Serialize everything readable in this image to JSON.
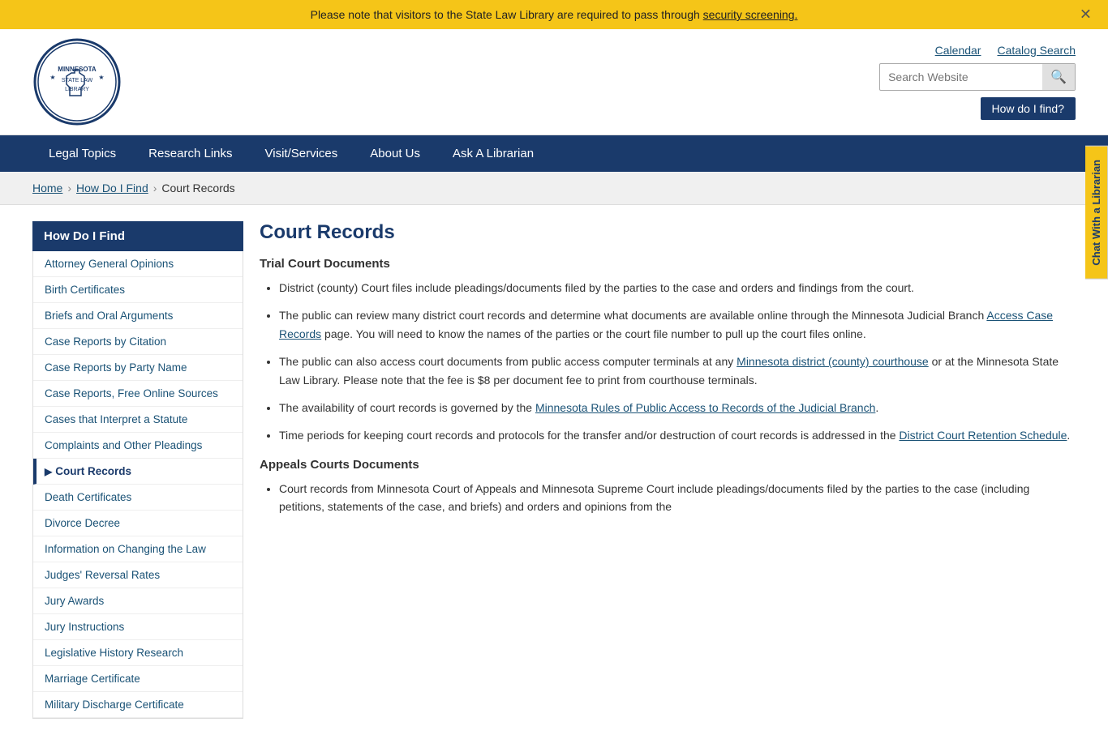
{
  "banner": {
    "text": "Please note that visitors to the State Law Library are required to pass through ",
    "link_text": "security screening.",
    "close_icon": "✕"
  },
  "header": {
    "links": [
      "Calendar",
      "Catalog Search"
    ],
    "search_placeholder": "Search Website",
    "how_do_i_find": "How do I find?",
    "logo_alt": "Minnesota State Law Library"
  },
  "nav": {
    "items": [
      "Legal Topics",
      "Research Links",
      "Visit/Services",
      "About Us",
      "Ask A Librarian"
    ]
  },
  "breadcrumb": {
    "items": [
      "Home",
      "How Do I Find",
      "Court Records"
    ]
  },
  "sidebar": {
    "header": "How Do I Find",
    "items": [
      {
        "label": "Attorney General Opinions",
        "active": false
      },
      {
        "label": "Birth Certificates",
        "active": false
      },
      {
        "label": "Briefs and Oral Arguments",
        "active": false
      },
      {
        "label": "Case Reports by Citation",
        "active": false
      },
      {
        "label": "Case Reports by Party Name",
        "active": false
      },
      {
        "label": "Case Reports, Free Online Sources",
        "active": false
      },
      {
        "label": "Cases that Interpret a Statute",
        "active": false
      },
      {
        "label": "Complaints and Other Pleadings",
        "active": false
      },
      {
        "label": "Court Records",
        "active": true
      },
      {
        "label": "Death Certificates",
        "active": false
      },
      {
        "label": "Divorce Decree",
        "active": false
      },
      {
        "label": "Information on Changing the Law",
        "active": false
      },
      {
        "label": "Judges' Reversal Rates",
        "active": false
      },
      {
        "label": "Jury Awards",
        "active": false
      },
      {
        "label": "Jury Instructions",
        "active": false
      },
      {
        "label": "Legislative History Research",
        "active": false
      },
      {
        "label": "Marriage Certificate",
        "active": false
      },
      {
        "label": "Military Discharge Certificate",
        "active": false
      }
    ]
  },
  "main": {
    "title": "Court Records",
    "section1_title": "Trial Court Documents",
    "bullet1": "District (county) Court files include pleadings/documents filed by the parties to the case and orders and findings from the court.",
    "bullet2_pre": "The public can review many district court records and determine what documents are available online through the Minnesota Judicial Branch ",
    "bullet2_link": "Access Case Records",
    "bullet2_post": " page.  You will need to know the names of the parties or the court file number to pull up the court files online.",
    "bullet3_pre": "The public can also access court documents from public access computer terminals at any ",
    "bullet3_link": "Minnesota district (county) courthouse",
    "bullet3_post": " or at the Minnesota State Law Library. Please note that the fee is $8 per document fee to print from courthouse terminals.",
    "bullet4_pre": "The availability of court records is governed by the ",
    "bullet4_link": "Minnesota Rules of Public Access to Records of the Judicial Branch",
    "bullet4_post": ".",
    "bullet5_pre": "Time periods for keeping court records and protocols for the transfer and/or destruction of court records is addressed in the ",
    "bullet5_link": "District Court Retention Schedule",
    "bullet5_post": ".",
    "section2_title": "Appeals Courts Documents",
    "bullet6": "Court records from Minnesota Court of Appeals and Minnesota Supreme Court include pleadings/documents filed by the parties to the case (including petitions, statements of the case, and briefs) and orders and opinions from the"
  },
  "chat": {
    "label": "Chat With a Librarian"
  }
}
